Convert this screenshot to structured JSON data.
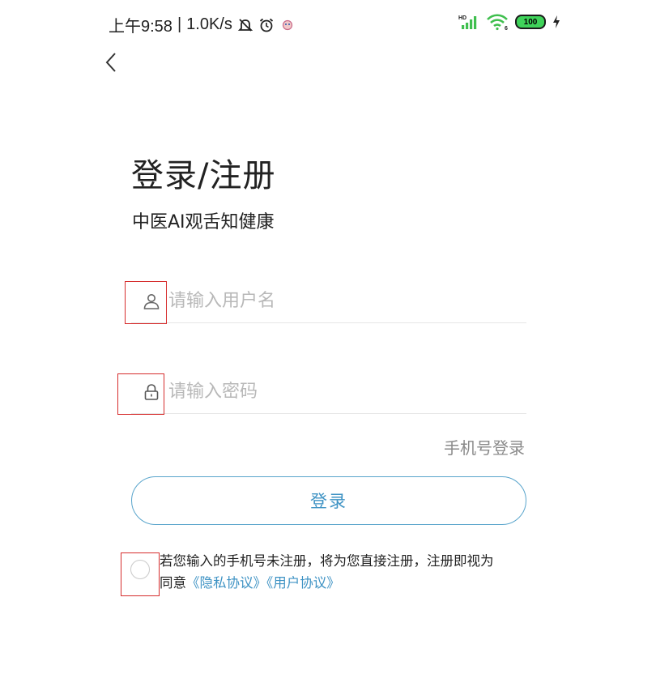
{
  "status_bar": {
    "time": "上午9:58",
    "separator": "|",
    "speed": "1.0K/s",
    "icons_left": [
      "bell-off-icon",
      "alarm-icon",
      "app-notification-icon"
    ],
    "network": "HD",
    "wifi_label": "6",
    "battery": "100",
    "charging": true
  },
  "header": {
    "back_icon": "chevron-left-icon"
  },
  "main": {
    "title": "登录/注册",
    "subtitle": "中医AI观舌知健康"
  },
  "form": {
    "username": {
      "placeholder": "请输入用户名",
      "value": "",
      "icon": "user-icon"
    },
    "password": {
      "placeholder": "请输入密码",
      "value": "",
      "icon": "lock-icon"
    },
    "phone_login_label": "手机号登录",
    "login_button_label": "登录"
  },
  "agreement": {
    "checked": false,
    "text_line1": "若您输入的手机号未注册，将为您直接注册，注册即视为",
    "text_prefix": "同意",
    "privacy_link": "《隐私协议》",
    "user_link": "《用户协议》"
  },
  "colors": {
    "accent": "#3f93c4",
    "button_border": "#5aa5cc",
    "placeholder": "#b8b8b8",
    "annotation_box": "#d62d2d",
    "battery_fill": "#3fd35a"
  }
}
